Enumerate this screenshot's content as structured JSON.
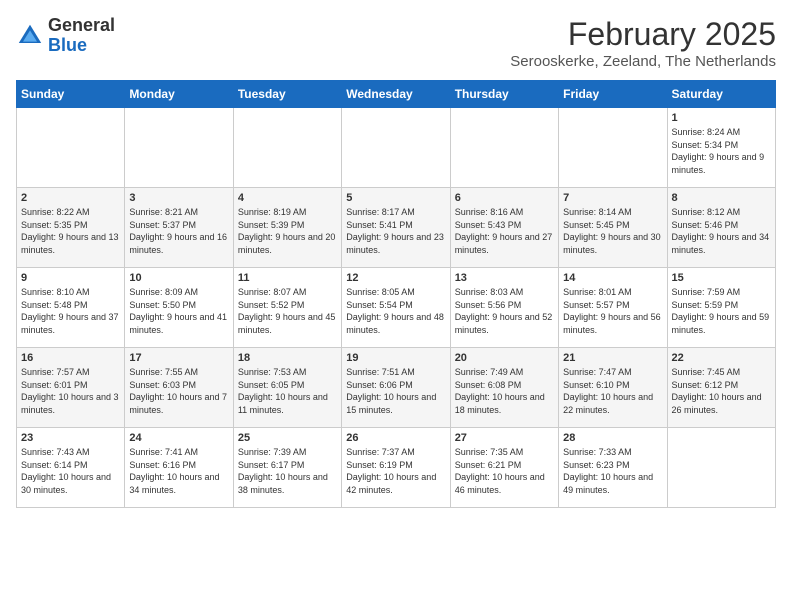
{
  "header": {
    "logo_general": "General",
    "logo_blue": "Blue",
    "month_title": "February 2025",
    "location": "Serooskerke, Zeeland, The Netherlands"
  },
  "days_of_week": [
    "Sunday",
    "Monday",
    "Tuesday",
    "Wednesday",
    "Thursday",
    "Friday",
    "Saturday"
  ],
  "weeks": [
    [
      {
        "day": "",
        "info": ""
      },
      {
        "day": "",
        "info": ""
      },
      {
        "day": "",
        "info": ""
      },
      {
        "day": "",
        "info": ""
      },
      {
        "day": "",
        "info": ""
      },
      {
        "day": "",
        "info": ""
      },
      {
        "day": "1",
        "info": "Sunrise: 8:24 AM\nSunset: 5:34 PM\nDaylight: 9 hours and 9 minutes."
      }
    ],
    [
      {
        "day": "2",
        "info": "Sunrise: 8:22 AM\nSunset: 5:35 PM\nDaylight: 9 hours and 13 minutes."
      },
      {
        "day": "3",
        "info": "Sunrise: 8:21 AM\nSunset: 5:37 PM\nDaylight: 9 hours and 16 minutes."
      },
      {
        "day": "4",
        "info": "Sunrise: 8:19 AM\nSunset: 5:39 PM\nDaylight: 9 hours and 20 minutes."
      },
      {
        "day": "5",
        "info": "Sunrise: 8:17 AM\nSunset: 5:41 PM\nDaylight: 9 hours and 23 minutes."
      },
      {
        "day": "6",
        "info": "Sunrise: 8:16 AM\nSunset: 5:43 PM\nDaylight: 9 hours and 27 minutes."
      },
      {
        "day": "7",
        "info": "Sunrise: 8:14 AM\nSunset: 5:45 PM\nDaylight: 9 hours and 30 minutes."
      },
      {
        "day": "8",
        "info": "Sunrise: 8:12 AM\nSunset: 5:46 PM\nDaylight: 9 hours and 34 minutes."
      }
    ],
    [
      {
        "day": "9",
        "info": "Sunrise: 8:10 AM\nSunset: 5:48 PM\nDaylight: 9 hours and 37 minutes."
      },
      {
        "day": "10",
        "info": "Sunrise: 8:09 AM\nSunset: 5:50 PM\nDaylight: 9 hours and 41 minutes."
      },
      {
        "day": "11",
        "info": "Sunrise: 8:07 AM\nSunset: 5:52 PM\nDaylight: 9 hours and 45 minutes."
      },
      {
        "day": "12",
        "info": "Sunrise: 8:05 AM\nSunset: 5:54 PM\nDaylight: 9 hours and 48 minutes."
      },
      {
        "day": "13",
        "info": "Sunrise: 8:03 AM\nSunset: 5:56 PM\nDaylight: 9 hours and 52 minutes."
      },
      {
        "day": "14",
        "info": "Sunrise: 8:01 AM\nSunset: 5:57 PM\nDaylight: 9 hours and 56 minutes."
      },
      {
        "day": "15",
        "info": "Sunrise: 7:59 AM\nSunset: 5:59 PM\nDaylight: 9 hours and 59 minutes."
      }
    ],
    [
      {
        "day": "16",
        "info": "Sunrise: 7:57 AM\nSunset: 6:01 PM\nDaylight: 10 hours and 3 minutes."
      },
      {
        "day": "17",
        "info": "Sunrise: 7:55 AM\nSunset: 6:03 PM\nDaylight: 10 hours and 7 minutes."
      },
      {
        "day": "18",
        "info": "Sunrise: 7:53 AM\nSunset: 6:05 PM\nDaylight: 10 hours and 11 minutes."
      },
      {
        "day": "19",
        "info": "Sunrise: 7:51 AM\nSunset: 6:06 PM\nDaylight: 10 hours and 15 minutes."
      },
      {
        "day": "20",
        "info": "Sunrise: 7:49 AM\nSunset: 6:08 PM\nDaylight: 10 hours and 18 minutes."
      },
      {
        "day": "21",
        "info": "Sunrise: 7:47 AM\nSunset: 6:10 PM\nDaylight: 10 hours and 22 minutes."
      },
      {
        "day": "22",
        "info": "Sunrise: 7:45 AM\nSunset: 6:12 PM\nDaylight: 10 hours and 26 minutes."
      }
    ],
    [
      {
        "day": "23",
        "info": "Sunrise: 7:43 AM\nSunset: 6:14 PM\nDaylight: 10 hours and 30 minutes."
      },
      {
        "day": "24",
        "info": "Sunrise: 7:41 AM\nSunset: 6:16 PM\nDaylight: 10 hours and 34 minutes."
      },
      {
        "day": "25",
        "info": "Sunrise: 7:39 AM\nSunset: 6:17 PM\nDaylight: 10 hours and 38 minutes."
      },
      {
        "day": "26",
        "info": "Sunrise: 7:37 AM\nSunset: 6:19 PM\nDaylight: 10 hours and 42 minutes."
      },
      {
        "day": "27",
        "info": "Sunrise: 7:35 AM\nSunset: 6:21 PM\nDaylight: 10 hours and 46 minutes."
      },
      {
        "day": "28",
        "info": "Sunrise: 7:33 AM\nSunset: 6:23 PM\nDaylight: 10 hours and 49 minutes."
      },
      {
        "day": "",
        "info": ""
      }
    ]
  ]
}
